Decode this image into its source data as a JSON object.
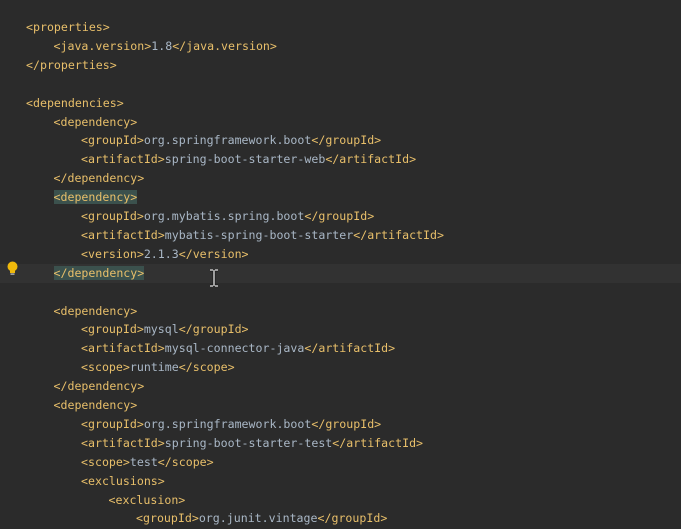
{
  "editor": {
    "language": "xml",
    "lines": [
      {
        "indent": 0,
        "parts": [
          {
            "t": "tag",
            "v": "<properties>"
          }
        ]
      },
      {
        "indent": 1,
        "parts": [
          {
            "t": "tag",
            "v": "<java.version>"
          },
          {
            "t": "txt",
            "v": "1.8"
          },
          {
            "t": "tag",
            "v": "</java.version>"
          }
        ]
      },
      {
        "indent": 0,
        "parts": [
          {
            "t": "tag",
            "v": "</properties>"
          }
        ]
      },
      {
        "indent": 0,
        "parts": []
      },
      {
        "indent": 0,
        "parts": [
          {
            "t": "tag",
            "v": "<dependencies>"
          }
        ]
      },
      {
        "indent": 1,
        "parts": [
          {
            "t": "tag",
            "v": "<dependency>"
          }
        ]
      },
      {
        "indent": 2,
        "parts": [
          {
            "t": "tag",
            "v": "<groupId>"
          },
          {
            "t": "txt",
            "v": "org.springframework.boot"
          },
          {
            "t": "tag",
            "v": "</groupId>"
          }
        ]
      },
      {
        "indent": 2,
        "parts": [
          {
            "t": "tag",
            "v": "<artifactId>"
          },
          {
            "t": "txt",
            "v": "spring-boot-starter-web"
          },
          {
            "t": "tag",
            "v": "</artifactId>"
          }
        ]
      },
      {
        "indent": 1,
        "parts": [
          {
            "t": "tag",
            "v": "</dependency>"
          }
        ]
      },
      {
        "indent": 1,
        "parts": [
          {
            "t": "tag",
            "v": "<dependency>",
            "match": true
          }
        ]
      },
      {
        "indent": 2,
        "parts": [
          {
            "t": "tag",
            "v": "<groupId>"
          },
          {
            "t": "txt",
            "v": "org.mybatis.spring.boot"
          },
          {
            "t": "tag",
            "v": "</groupId>"
          }
        ]
      },
      {
        "indent": 2,
        "parts": [
          {
            "t": "tag",
            "v": "<artifactId>"
          },
          {
            "t": "txt",
            "v": "mybatis-spring-boot-starter"
          },
          {
            "t": "tag",
            "v": "</artifactId>"
          }
        ]
      },
      {
        "indent": 2,
        "parts": [
          {
            "t": "tag",
            "v": "<version>"
          },
          {
            "t": "txt",
            "v": "2.1.3"
          },
          {
            "t": "tag",
            "v": "</version>"
          }
        ]
      },
      {
        "indent": 1,
        "current": true,
        "parts": [
          {
            "t": "tag",
            "v": "</dependency>",
            "match": true
          }
        ]
      },
      {
        "indent": 0,
        "parts": []
      },
      {
        "indent": 1,
        "parts": [
          {
            "t": "tag",
            "v": "<dependency>"
          }
        ]
      },
      {
        "indent": 2,
        "parts": [
          {
            "t": "tag",
            "v": "<groupId>"
          },
          {
            "t": "txt",
            "v": "mysql"
          },
          {
            "t": "tag",
            "v": "</groupId>"
          }
        ]
      },
      {
        "indent": 2,
        "parts": [
          {
            "t": "tag",
            "v": "<artifactId>"
          },
          {
            "t": "txt",
            "v": "mysql-connector-java"
          },
          {
            "t": "tag",
            "v": "</artifactId>"
          }
        ]
      },
      {
        "indent": 2,
        "parts": [
          {
            "t": "tag",
            "v": "<scope>"
          },
          {
            "t": "txt",
            "v": "runtime"
          },
          {
            "t": "tag",
            "v": "</scope>"
          }
        ]
      },
      {
        "indent": 1,
        "parts": [
          {
            "t": "tag",
            "v": "</dependency>"
          }
        ]
      },
      {
        "indent": 1,
        "parts": [
          {
            "t": "tag",
            "v": "<dependency>"
          }
        ]
      },
      {
        "indent": 2,
        "parts": [
          {
            "t": "tag",
            "v": "<groupId>"
          },
          {
            "t": "txt",
            "v": "org.springframework.boot"
          },
          {
            "t": "tag",
            "v": "</groupId>"
          }
        ]
      },
      {
        "indent": 2,
        "parts": [
          {
            "t": "tag",
            "v": "<artifactId>"
          },
          {
            "t": "txt",
            "v": "spring-boot-starter-test"
          },
          {
            "t": "tag",
            "v": "</artifactId>"
          }
        ]
      },
      {
        "indent": 2,
        "parts": [
          {
            "t": "tag",
            "v": "<scope>"
          },
          {
            "t": "txt",
            "v": "test"
          },
          {
            "t": "tag",
            "v": "</scope>"
          }
        ]
      },
      {
        "indent": 2,
        "parts": [
          {
            "t": "tag",
            "v": "<exclusions>"
          }
        ]
      },
      {
        "indent": 3,
        "parts": [
          {
            "t": "tag",
            "v": "<exclusion>"
          }
        ]
      },
      {
        "indent": 4,
        "parts": [
          {
            "t": "tag",
            "v": "<groupId>"
          },
          {
            "t": "txt",
            "v": "org.junit.vintage"
          },
          {
            "t": "tag",
            "v": "</groupId>"
          }
        ]
      }
    ]
  },
  "gutter": {
    "intention_icon": "lightbulb-icon"
  },
  "pointer": {
    "icon": "text-cursor-icon"
  },
  "colors": {
    "background": "#2b2b2b",
    "current_line": "#323232",
    "tag": "#e8bf6a",
    "text": "#a9b7c6",
    "tag_match_highlight": "#3b514d",
    "bulb": "#f0b90b"
  }
}
